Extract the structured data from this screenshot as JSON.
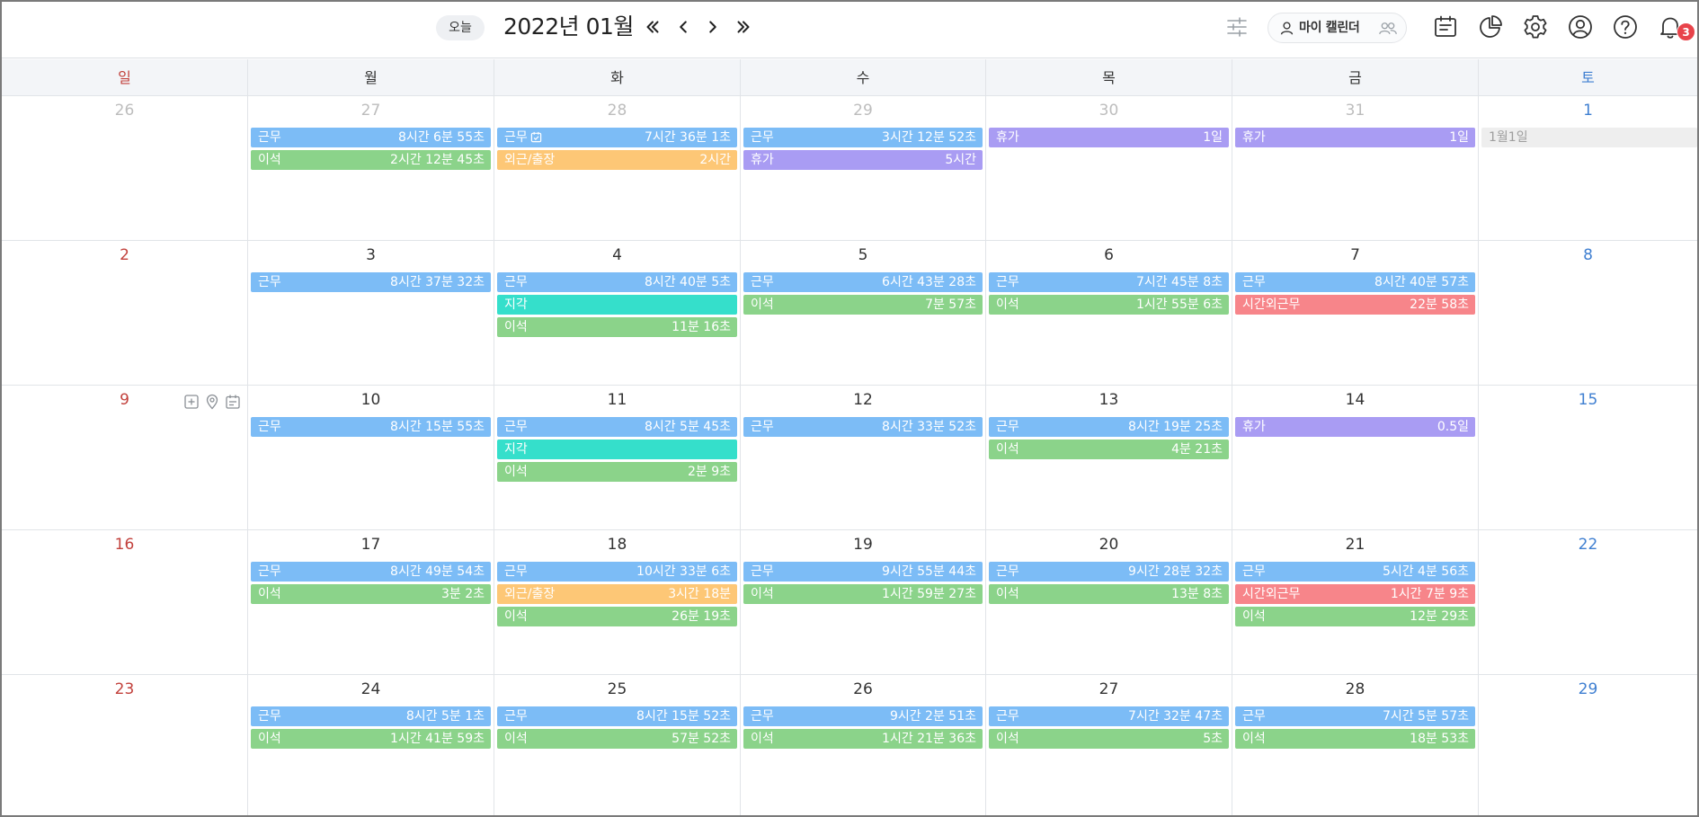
{
  "colors": {
    "work": "#7cbcf6",
    "away": "#8bd38a",
    "outside": "#fdc776",
    "leave": "#a99cf3",
    "late": "#35dfcb",
    "overtime": "#f7858a",
    "holiday": "#eeeeee"
  },
  "header": {
    "today_label": "오늘",
    "month_title": "2022년 01월",
    "my_calendar_label": "마이 캘린더",
    "notification_count": "3",
    "icons": [
      "filter-sliders-icon",
      "user-icon",
      "group-icon",
      "schedule-list-icon",
      "pie-chart-icon",
      "gear-icon",
      "account-circle-icon",
      "help-icon",
      "bell-icon"
    ]
  },
  "weekdays": [
    "일",
    "월",
    "화",
    "수",
    "목",
    "금",
    "토"
  ],
  "weeks": [
    [
      {
        "date": "26",
        "other": true,
        "events": []
      },
      {
        "date": "27",
        "other": true,
        "events": [
          {
            "type": "work",
            "label": "근무",
            "value": "8시간 6분 55초"
          },
          {
            "type": "away",
            "label": "이석",
            "value": "2시간 12분 45초"
          }
        ]
      },
      {
        "date": "28",
        "other": true,
        "events": [
          {
            "type": "work",
            "label": "근무",
            "value": "7시간 36분 1초",
            "approved": true
          },
          {
            "type": "outside",
            "label": "외근/출장",
            "value": "2시간"
          }
        ]
      },
      {
        "date": "29",
        "other": true,
        "events": [
          {
            "type": "work",
            "label": "근무",
            "value": "3시간 12분 52초"
          },
          {
            "type": "leave",
            "label": "휴가",
            "value": "5시간"
          }
        ]
      },
      {
        "date": "30",
        "other": true,
        "events": [
          {
            "type": "leave",
            "label": "휴가",
            "value": "1일"
          }
        ]
      },
      {
        "date": "31",
        "other": true,
        "events": [
          {
            "type": "leave",
            "label": "휴가",
            "value": "1일"
          }
        ]
      },
      {
        "date": "1",
        "events": [
          {
            "type": "holiday",
            "label": "1월1일",
            "value": ""
          }
        ]
      }
    ],
    [
      {
        "date": "2",
        "events": []
      },
      {
        "date": "3",
        "events": [
          {
            "type": "work",
            "label": "근무",
            "value": "8시간 37분 32초"
          }
        ]
      },
      {
        "date": "4",
        "events": [
          {
            "type": "work",
            "label": "근무",
            "value": "8시간 40분 5초"
          },
          {
            "type": "late",
            "label": "지각",
            "value": ""
          },
          {
            "type": "away",
            "label": "이석",
            "value": "11분 16초"
          }
        ]
      },
      {
        "date": "5",
        "events": [
          {
            "type": "work",
            "label": "근무",
            "value": "6시간 43분 28초"
          },
          {
            "type": "away",
            "label": "이석",
            "value": "7분 57초"
          }
        ]
      },
      {
        "date": "6",
        "events": [
          {
            "type": "work",
            "label": "근무",
            "value": "7시간 45분 8초"
          },
          {
            "type": "away",
            "label": "이석",
            "value": "1시간 55분 6초"
          }
        ]
      },
      {
        "date": "7",
        "events": [
          {
            "type": "work",
            "label": "근무",
            "value": "8시간 40분 57초"
          },
          {
            "type": "overtime",
            "label": "시간외근무",
            "value": "22분 58초"
          }
        ]
      },
      {
        "date": "8",
        "events": []
      }
    ],
    [
      {
        "date": "9",
        "tools": true,
        "events": []
      },
      {
        "date": "10",
        "events": [
          {
            "type": "work",
            "label": "근무",
            "value": "8시간 15분 55초"
          }
        ]
      },
      {
        "date": "11",
        "events": [
          {
            "type": "work",
            "label": "근무",
            "value": "8시간 5분 45초"
          },
          {
            "type": "late",
            "label": "지각",
            "value": ""
          },
          {
            "type": "away",
            "label": "이석",
            "value": "2분 9초"
          }
        ]
      },
      {
        "date": "12",
        "events": [
          {
            "type": "work",
            "label": "근무",
            "value": "8시간 33분 52초"
          }
        ]
      },
      {
        "date": "13",
        "events": [
          {
            "type": "work",
            "label": "근무",
            "value": "8시간 19분 25초"
          },
          {
            "type": "away",
            "label": "이석",
            "value": "4분 21초"
          }
        ]
      },
      {
        "date": "14",
        "events": [
          {
            "type": "leave",
            "label": "휴가",
            "value": "0.5일"
          }
        ]
      },
      {
        "date": "15",
        "events": []
      }
    ],
    [
      {
        "date": "16",
        "events": []
      },
      {
        "date": "17",
        "events": [
          {
            "type": "work",
            "label": "근무",
            "value": "8시간 49분 54초"
          },
          {
            "type": "away",
            "label": "이석",
            "value": "3분 2초"
          }
        ]
      },
      {
        "date": "18",
        "events": [
          {
            "type": "work",
            "label": "근무",
            "value": "10시간 33분 6초"
          },
          {
            "type": "outside",
            "label": "외근/출장",
            "value": "3시간 18분"
          },
          {
            "type": "away",
            "label": "이석",
            "value": "26분 19초"
          }
        ]
      },
      {
        "date": "19",
        "events": [
          {
            "type": "work",
            "label": "근무",
            "value": "9시간 55분 44초"
          },
          {
            "type": "away",
            "label": "이석",
            "value": "1시간 59분 27초"
          }
        ]
      },
      {
        "date": "20",
        "events": [
          {
            "type": "work",
            "label": "근무",
            "value": "9시간 28분 32초"
          },
          {
            "type": "away",
            "label": "이석",
            "value": "13분 8초"
          }
        ]
      },
      {
        "date": "21",
        "events": [
          {
            "type": "work",
            "label": "근무",
            "value": "5시간 4분 56초"
          },
          {
            "type": "overtime",
            "label": "시간외근무",
            "value": "1시간 7분 9초"
          },
          {
            "type": "away",
            "label": "이석",
            "value": "12분 29초"
          }
        ]
      },
      {
        "date": "22",
        "events": []
      }
    ],
    [
      {
        "date": "23",
        "events": []
      },
      {
        "date": "24",
        "events": [
          {
            "type": "work",
            "label": "근무",
            "value": "8시간 5분 1초"
          },
          {
            "type": "away",
            "label": "이석",
            "value": "1시간 41분 59초"
          }
        ]
      },
      {
        "date": "25",
        "events": [
          {
            "type": "work",
            "label": "근무",
            "value": "8시간 15분 52초"
          },
          {
            "type": "away",
            "label": "이석",
            "value": "57분 52초"
          }
        ]
      },
      {
        "date": "26",
        "events": [
          {
            "type": "work",
            "label": "근무",
            "value": "9시간 2분 51초"
          },
          {
            "type": "away",
            "label": "이석",
            "value": "1시간 21분 36초"
          }
        ]
      },
      {
        "date": "27",
        "events": [
          {
            "type": "work",
            "label": "근무",
            "value": "7시간 32분 47초"
          },
          {
            "type": "away",
            "label": "이석",
            "value": "5초"
          }
        ]
      },
      {
        "date": "28",
        "events": [
          {
            "type": "work",
            "label": "근무",
            "value": "7시간 5분 57초"
          },
          {
            "type": "away",
            "label": "이석",
            "value": "18분 53초"
          }
        ]
      },
      {
        "date": "29",
        "events": []
      }
    ]
  ]
}
